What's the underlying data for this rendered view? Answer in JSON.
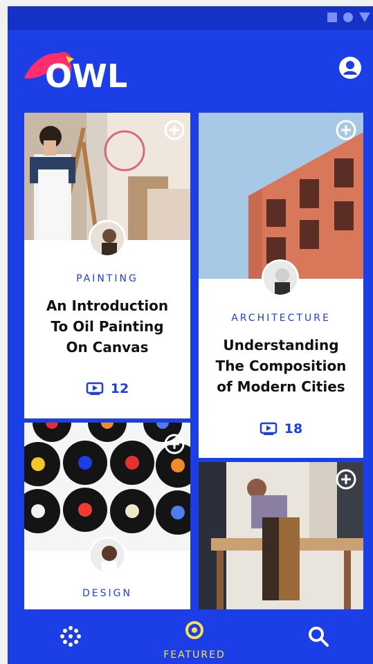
{
  "app": {
    "name": "OWL",
    "accent": "#1b3ee6",
    "highlight": "#ffe24a"
  },
  "statusbar": {
    "icons": [
      "square-icon",
      "circle-icon",
      "triangle-icon"
    ]
  },
  "header": {
    "logo_text": "OWL",
    "profile_icon": "profile-icon"
  },
  "cards": [
    {
      "category": "PAINTING",
      "title_lines": [
        "An Introduction",
        "To Oil Painting",
        "On Canvas"
      ],
      "lessons": "12"
    },
    {
      "category": "ARCHITECTURE",
      "title_lines": [
        "Understanding",
        "The Composition",
        "of Modern Cities"
      ],
      "lessons": "18"
    },
    {
      "category": "DESIGN"
    },
    {}
  ],
  "bottom_nav": {
    "items": [
      {
        "icon": "dots-grid-icon"
      },
      {
        "icon": "featured-circle-icon",
        "label": "FEATURED"
      },
      {
        "icon": "search-icon"
      }
    ]
  }
}
